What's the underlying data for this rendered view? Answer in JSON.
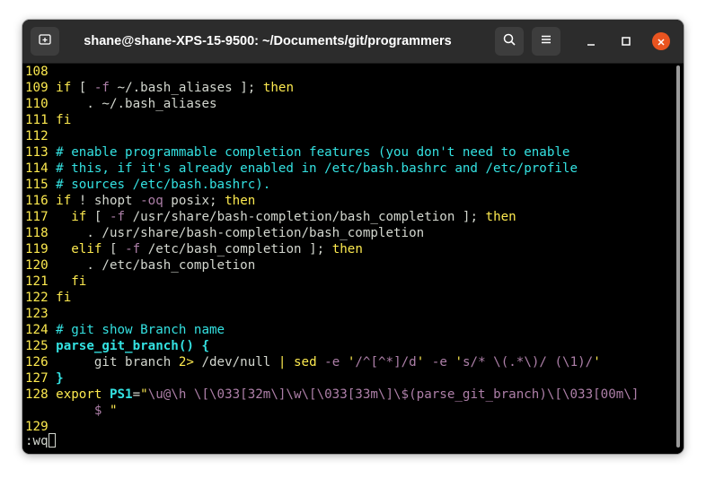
{
  "window": {
    "title": "shane@shane-XPS-15-9500: ~/Documents/git/programmers"
  },
  "icons": {
    "new_tab": "new-tab-icon",
    "search": "search-icon",
    "menu": "hamburger-menu-icon",
    "minimize": "minimize-icon",
    "maximize": "maximize-icon",
    "close": "close-icon"
  },
  "colors": {
    "line_number": "#fce94f",
    "comment": "#34e2e2",
    "keyword": "#fce94f",
    "string": "#ad7fa8",
    "function": "#34e2e2",
    "close_button": "#e95420"
  },
  "lines": [
    {
      "num": "108",
      "segments": []
    },
    {
      "num": "109",
      "segments": [
        {
          "t": "kw",
          "s": "if"
        },
        {
          "t": "tx",
          "s": " [ "
        },
        {
          "t": "op",
          "s": "-f"
        },
        {
          "t": "tx",
          "s": " ~/.bash_aliases ]; "
        },
        {
          "t": "kw",
          "s": "then"
        }
      ]
    },
    {
      "num": "110",
      "segments": [
        {
          "t": "tx",
          "s": "    . ~/.bash_aliases"
        }
      ]
    },
    {
      "num": "111",
      "segments": [
        {
          "t": "kw",
          "s": "fi"
        }
      ]
    },
    {
      "num": "112",
      "segments": []
    },
    {
      "num": "113",
      "segments": [
        {
          "t": "cm",
          "s": "# enable programmable completion features (you don't need to enable"
        }
      ]
    },
    {
      "num": "114",
      "segments": [
        {
          "t": "cm",
          "s": "# this, if it's already enabled in /etc/bash.bashrc and /etc/profile"
        }
      ]
    },
    {
      "num": "115",
      "segments": [
        {
          "t": "cm",
          "s": "# sources /etc/bash.bashrc)."
        }
      ]
    },
    {
      "num": "116",
      "segments": [
        {
          "t": "kw",
          "s": "if"
        },
        {
          "t": "tx",
          "s": " ! shopt "
        },
        {
          "t": "op",
          "s": "-oq"
        },
        {
          "t": "tx",
          "s": " posix; "
        },
        {
          "t": "kw",
          "s": "then"
        }
      ]
    },
    {
      "num": "117",
      "segments": [
        {
          "t": "tx",
          "s": "  "
        },
        {
          "t": "kw",
          "s": "if"
        },
        {
          "t": "tx",
          "s": " [ "
        },
        {
          "t": "op",
          "s": "-f"
        },
        {
          "t": "tx",
          "s": " /usr/share/bash-completion/bash_completion ]; "
        },
        {
          "t": "kw",
          "s": "then"
        }
      ]
    },
    {
      "num": "118",
      "segments": [
        {
          "t": "tx",
          "s": "    . /usr/share/bash-completion/bash_completion"
        }
      ]
    },
    {
      "num": "119",
      "segments": [
        {
          "t": "tx",
          "s": "  "
        },
        {
          "t": "kw",
          "s": "elif"
        },
        {
          "t": "tx",
          "s": " [ "
        },
        {
          "t": "op",
          "s": "-f"
        },
        {
          "t": "tx",
          "s": " /etc/bash_completion ]; "
        },
        {
          "t": "kw",
          "s": "then"
        }
      ]
    },
    {
      "num": "120",
      "segments": [
        {
          "t": "tx",
          "s": "    . /etc/bash_completion"
        }
      ]
    },
    {
      "num": "121",
      "segments": [
        {
          "t": "tx",
          "s": "  "
        },
        {
          "t": "kw",
          "s": "fi"
        }
      ]
    },
    {
      "num": "122",
      "segments": [
        {
          "t": "kw",
          "s": "fi"
        }
      ]
    },
    {
      "num": "123",
      "segments": []
    },
    {
      "num": "124",
      "segments": [
        {
          "t": "cm",
          "s": "# git show Branch name"
        }
      ]
    },
    {
      "num": "125",
      "segments": [
        {
          "t": "fnb",
          "s": "parse_git_branch() {"
        }
      ]
    },
    {
      "num": "126",
      "segments": [
        {
          "t": "tx",
          "s": "     git branch "
        },
        {
          "t": "kw",
          "s": "2>"
        },
        {
          "t": "tx",
          "s": " /dev/null "
        },
        {
          "t": "kw",
          "s": "|"
        },
        {
          "t": "tx",
          "s": " "
        },
        {
          "t": "kw",
          "s": "sed"
        },
        {
          "t": "tx",
          "s": " "
        },
        {
          "t": "op",
          "s": "-e"
        },
        {
          "t": "tx",
          "s": " "
        },
        {
          "t": "kw",
          "s": "'"
        },
        {
          "t": "st",
          "s": "/^[^*]/d"
        },
        {
          "t": "kw",
          "s": "'"
        },
        {
          "t": "tx",
          "s": " "
        },
        {
          "t": "op",
          "s": "-e"
        },
        {
          "t": "tx",
          "s": " "
        },
        {
          "t": "kw",
          "s": "'"
        },
        {
          "t": "st",
          "s": "s/* \\(.*\\)/ (\\1)/"
        },
        {
          "t": "kw",
          "s": "'"
        }
      ]
    },
    {
      "num": "127",
      "segments": [
        {
          "t": "fnb",
          "s": "}"
        }
      ]
    },
    {
      "num": "128",
      "segments": [
        {
          "t": "kw",
          "s": "export"
        },
        {
          "t": "tx",
          "s": " "
        },
        {
          "t": "id",
          "s": "PS1"
        },
        {
          "t": "tx",
          "s": "="
        },
        {
          "t": "kw",
          "s": "\""
        },
        {
          "t": "st",
          "s": "\\u@\\h \\[\\033[32m\\]\\w\\[\\033[33m\\]\\$"
        },
        {
          "t": "op",
          "s": "(parse_git_branch)"
        },
        {
          "t": "st",
          "s": "\\[\\033[00m\\]"
        }
      ]
    },
    {
      "num": "",
      "segments": [
        {
          "t": "st",
          "s": "     $ "
        },
        {
          "t": "kw",
          "s": "\""
        }
      ]
    },
    {
      "num": "129",
      "segments": []
    }
  ],
  "command_line": ":wq"
}
